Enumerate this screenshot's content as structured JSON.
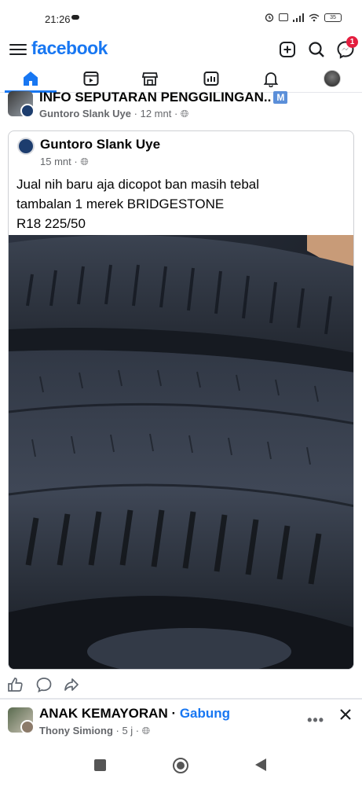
{
  "status": {
    "time": "21:26",
    "battery": "35"
  },
  "header": {
    "logo": "facebook",
    "messenger_badge": "1"
  },
  "tabs": [
    {
      "name": "home",
      "icon": "home-icon",
      "active": true
    },
    {
      "name": "watch",
      "icon": "video-icon"
    },
    {
      "name": "marketplace",
      "icon": "store-icon"
    },
    {
      "name": "feeds",
      "icon": "feeds-icon"
    },
    {
      "name": "notifications",
      "icon": "bell-icon"
    },
    {
      "name": "profile",
      "icon": "avatar-icon"
    }
  ],
  "post": {
    "group": "INFO SEPUTARAN PENGGILINGAN..",
    "group_badge": "M",
    "author": "Guntoro Slank Uye",
    "time": "12 mnt",
    "shared": {
      "author": "Guntoro Slank Uye",
      "time": "15 mnt",
      "text_lines": [
        "Jual nih baru aja dicopot ban masih tebal",
        "tambalan 1 merek BRIDGESTONE",
        "R18 225/50"
      ]
    }
  },
  "next_post": {
    "group": "ANAK KEMAYORAN",
    "join_label": "Gabung",
    "author": "Thony Simiong",
    "time": "5 j"
  },
  "colors": {
    "accent": "#1877f2",
    "badge": "#e41e3f",
    "meta": "#65676b"
  }
}
